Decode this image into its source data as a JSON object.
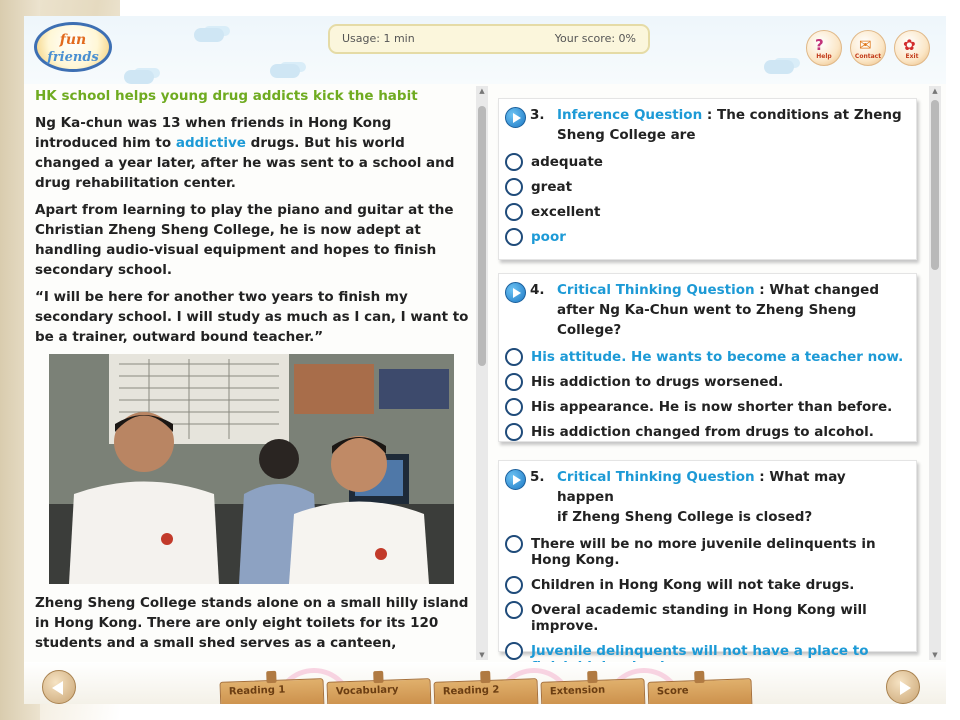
{
  "header": {
    "logo": {
      "line1": "fun",
      "line2": "friends"
    },
    "usage": "Usage: 1 min",
    "score": "Your score: 0%",
    "buttons": [
      {
        "name": "help",
        "label": "Help",
        "icon": "?"
      },
      {
        "name": "contact",
        "label": "Contact",
        "icon": "✉"
      },
      {
        "name": "exit",
        "label": "Exit",
        "icon": "✿"
      }
    ]
  },
  "article": {
    "title": "HK school helps young drug addicts kick the habit",
    "p1_before": "Ng Ka-chun was 13 when friends in Hong Kong introduced him to ",
    "p1_keyword": "addictive",
    "p1_after": " drugs. But his world changed a year later, after he was sent to a school and drug rehabilitation center.",
    "p2": "Apart from learning to play the piano and guitar at the Christian Zheng Sheng College, he is now adept at handling audio-visual equipment and hopes to finish secondary school.",
    "p3": "“I will be here for another two years to finish my secondary school.  I will study as much as I can, I want to be a trainer, outward bound teacher.”",
    "p4": "Zheng Sheng College stands alone on a small hilly island in Hong Kong. There are only eight toilets for its 120 students and a small shed serves as a canteen,"
  },
  "questions": [
    {
      "number": "3.",
      "type": "Inference Question",
      "line1": " : The conditions at Zheng",
      "line2": "Sheng College are",
      "options": [
        {
          "text": "adequate",
          "selected": false
        },
        {
          "text": "great",
          "selected": false
        },
        {
          "text": "excellent",
          "selected": false
        },
        {
          "text": "poor",
          "selected": true
        }
      ]
    },
    {
      "number": "4.",
      "type": "Critical Thinking Question",
      "line1": " : What changed",
      "line2": "after Ng Ka-Chun went to Zheng Sheng College?",
      "options": [
        {
          "text": "His attitude.  He wants to become a teacher now.",
          "selected": true
        },
        {
          "text": "His addiction to drugs worsened.",
          "selected": false
        },
        {
          "text": "His appearance. He is now shorter than before.",
          "selected": false
        },
        {
          "text": "His addiction changed from drugs to alcohol.",
          "selected": false
        }
      ]
    },
    {
      "number": "5.",
      "type": "Critical Thinking Question",
      "line1": " : What may happen",
      "line2": "if Zheng Sheng College is closed?",
      "options": [
        {
          "text": "There will be no more juvenile delinquents in Hong Kong.",
          "selected": false
        },
        {
          "text": "Children in Hong Kong will not take drugs.",
          "selected": false
        },
        {
          "text": "Overal academic standing in Hong Kong will improve.",
          "selected": false
        },
        {
          "text": "Juvenile delinquents will not have a place to finish high school.",
          "selected": true
        }
      ]
    }
  ],
  "footer": {
    "tabs": [
      "Reading 1",
      "Vocabulary",
      "Reading 2",
      "Extension",
      "Score"
    ]
  },
  "colors": {
    "title_green": "#6fab20",
    "keyword_blue": "#1d9ad6",
    "radio_border": "#1f4b7a"
  }
}
